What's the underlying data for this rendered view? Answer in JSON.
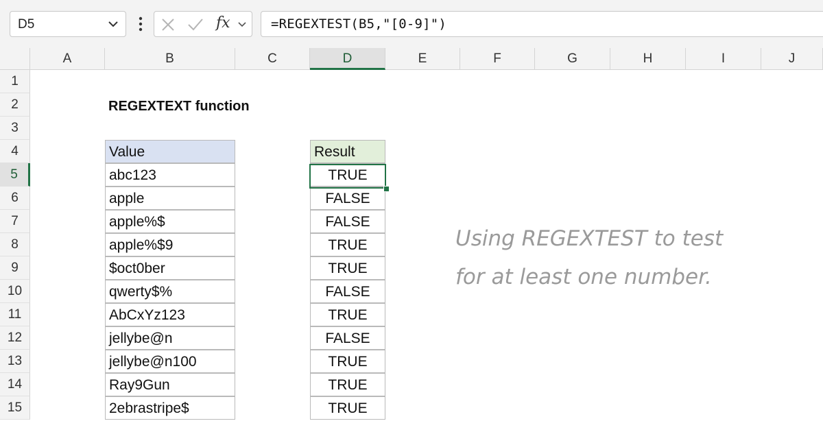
{
  "formula_bar": {
    "name_box": "D5",
    "formula": "=REGEXTEST(B5,\"[0-9]\")",
    "fx_label": "fx"
  },
  "columns": [
    "A",
    "B",
    "C",
    "D",
    "E",
    "F",
    "G",
    "H",
    "I",
    "J"
  ],
  "rows": [
    "1",
    "2",
    "3",
    "4",
    "5",
    "6",
    "7",
    "8",
    "9",
    "10",
    "11",
    "12",
    "13",
    "14",
    "15"
  ],
  "selected_cell": {
    "column": "D",
    "row": "5"
  },
  "sheet": {
    "title": "REGEXTEXT function",
    "value_header": "Value",
    "result_header": "Result",
    "data": [
      {
        "value": "abc123",
        "result": "TRUE"
      },
      {
        "value": "apple",
        "result": "FALSE"
      },
      {
        "value": "apple%$",
        "result": "FALSE"
      },
      {
        "value": "apple%$9",
        "result": "TRUE"
      },
      {
        "value": "$oct0ber",
        "result": "TRUE"
      },
      {
        "value": "qwerty$%",
        "result": "FALSE"
      },
      {
        "value": "AbCxYz123",
        "result": "TRUE"
      },
      {
        "value": "jellybe@n",
        "result": "FALSE"
      },
      {
        "value": "jellybe@n100",
        "result": "TRUE"
      },
      {
        "value": "Ray9Gun",
        "result": "TRUE"
      },
      {
        "value": "2ebrastripe$",
        "result": "TRUE"
      }
    ],
    "note_line1": "Using REGEXTEST to test",
    "note_line2": "for at least one number."
  },
  "colors": {
    "accent": "#217346",
    "value_header_bg": "#d9e1f2",
    "result_header_bg": "#e2efda"
  }
}
